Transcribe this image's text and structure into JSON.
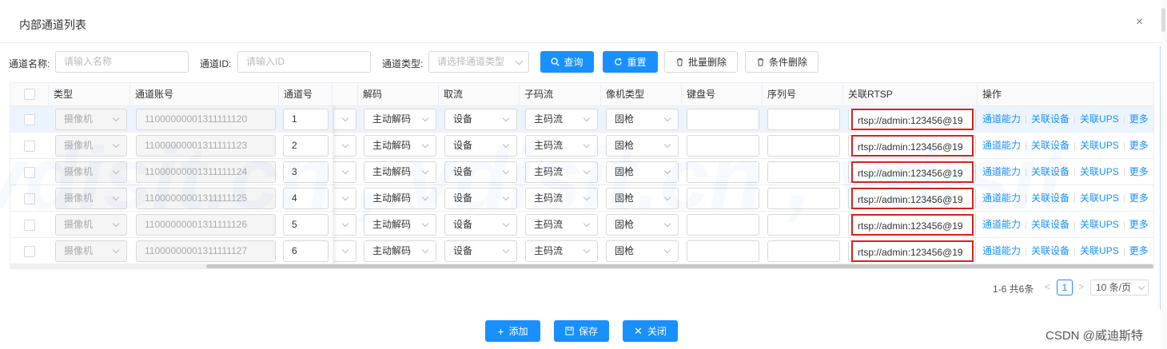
{
  "dialog": {
    "title": "内部通道列表",
    "close_icon": "×"
  },
  "filters": {
    "name_label": "通道名称:",
    "name_placeholder": "请输入名称",
    "id_label": "通道ID:",
    "id_placeholder": "请输入ID",
    "type_label": "通道类型:",
    "type_placeholder": "请选择通道类型",
    "query": "查询",
    "reset": "重置",
    "batch_delete": "批量删除",
    "cond_delete": "条件删除"
  },
  "table": {
    "headers": {
      "type": "类型",
      "account": "通道账号",
      "channel": "通道号",
      "decode": "解码",
      "stream": "取流",
      "substream": "子码流",
      "camera": "像机类型",
      "keyboard": "键盘号",
      "serial": "序列号",
      "rtsp": "关联RTSP",
      "ops": "操作"
    },
    "rows": [
      {
        "type": "摄像机",
        "account": "11000000001311111120",
        "channel": "1",
        "decode": "主动解码",
        "stream": "设备",
        "substream": "主码流",
        "camera": "固枪",
        "rtsp": "rtsp://admin:123456@19"
      },
      {
        "type": "摄像机",
        "account": "11000000001311111123",
        "channel": "2",
        "decode": "主动解码",
        "stream": "设备",
        "substream": "主码流",
        "camera": "固枪",
        "rtsp": "rtsp://admin:123456@19"
      },
      {
        "type": "摄像机",
        "account": "11000000001311111124",
        "channel": "3",
        "decode": "主动解码",
        "stream": "设备",
        "substream": "主码流",
        "camera": "固枪",
        "rtsp": "rtsp://admin:123456@19"
      },
      {
        "type": "摄像机",
        "account": "11000000001311111125",
        "channel": "4",
        "decode": "主动解码",
        "stream": "设备",
        "substream": "主码流",
        "camera": "固枪",
        "rtsp": "rtsp://admin:123456@19"
      },
      {
        "type": "摄像机",
        "account": "11000000001311111126",
        "channel": "5",
        "decode": "主动解码",
        "stream": "设备",
        "substream": "主码流",
        "camera": "固枪",
        "rtsp": "rtsp://admin:123456@19"
      },
      {
        "type": "摄像机",
        "account": "11000000001311111127",
        "channel": "6",
        "decode": "主动解码",
        "stream": "设备",
        "substream": "主码流",
        "camera": "固枪",
        "rtsp": "rtsp://admin:123456@19"
      }
    ],
    "ops": {
      "capability": "通道能力",
      "link_device": "关联设备",
      "link_ups": "关联UPS",
      "more": "更多"
    }
  },
  "pagination": {
    "summary": "1-6 共6条",
    "prev": "<",
    "current": "1",
    "next": ">",
    "page_size": "10 条/页"
  },
  "footer": {
    "add": "添加",
    "save": "保存",
    "close": "关闭"
  },
  "watermark": {
    "text": "vdisit.cn , vdisit.cn , vdisit"
  },
  "csdn": "CSDN @威迪斯特",
  "colors": {
    "primary": "#1890ff",
    "highlight_border": "#d9221c"
  }
}
